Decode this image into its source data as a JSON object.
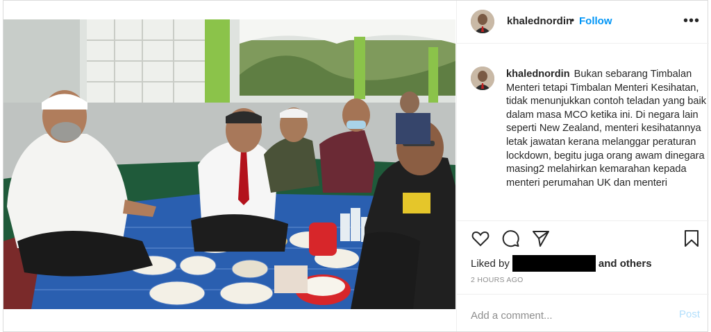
{
  "post": {
    "username": "khalednordin",
    "header_separator": "•",
    "follow_label": "Follow",
    "more_label": "•••",
    "caption": "Bukan sebarang Timbalan Menteri tetapi Timbalan Menteri Kesihatan, tidak menunjukkan contoh teladan yang baik dalam masa MCO ketika ini. Di negara lain seperti New Zealand, menteri kesihatannya letak jawatan kerana melanggar peraturan lockdown, begitu juga orang awam dinegara masing2 melahirkan kemarahan kepada menteri perumahan UK dan menteri",
    "liked_by_prefix": "Liked by",
    "liked_by_suffix": "and others",
    "timestamp": "2 HOURS AGO",
    "comment_placeholder": "Add a comment...",
    "post_button": "Post"
  },
  "icons": {
    "more": "more-options-icon",
    "like": "heart-icon",
    "comment": "comment-bubble-icon",
    "share": "paper-plane-icon",
    "save": "bookmark-icon"
  },
  "colors": {
    "accent": "#0095f6",
    "post_disabled": "#b2dffc",
    "meta_gray": "#8e8e8e",
    "border": "#dbdbdb"
  }
}
